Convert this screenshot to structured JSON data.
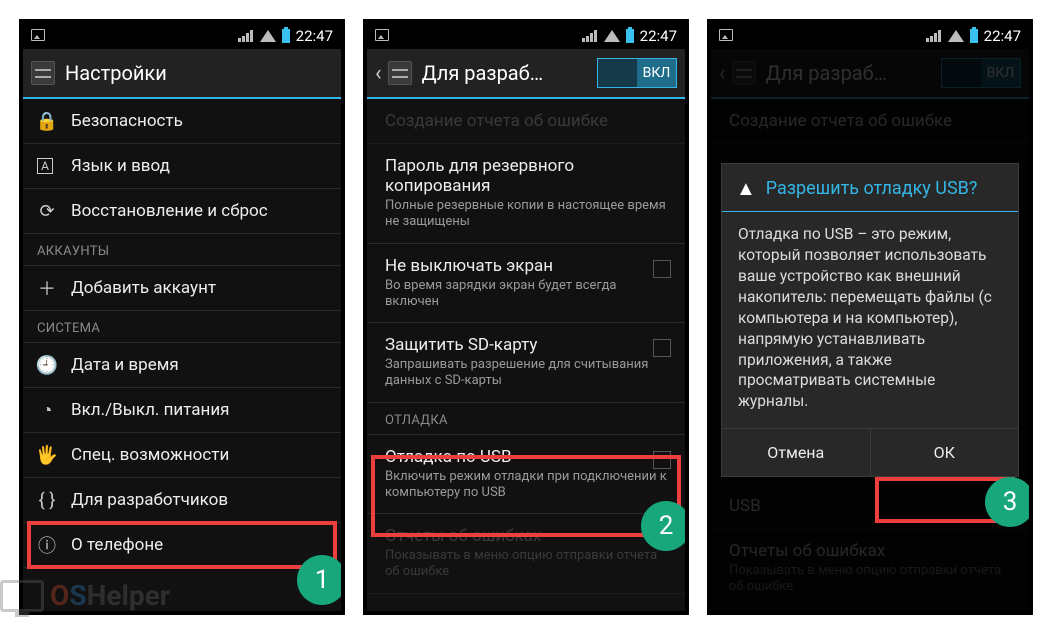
{
  "status": {
    "time": "22:47"
  },
  "watermark": {
    "o": "O",
    "s": "S",
    "h": "Helper"
  },
  "steps": [
    "1",
    "2",
    "3"
  ],
  "phone1": {
    "title": "Настройки",
    "items": [
      {
        "icon": "🔒",
        "label": "Безопасность"
      },
      {
        "icon": "A",
        "label": "Язык и ввод",
        "iconStyle": "letter"
      },
      {
        "icon": "⟳",
        "label": "Восстановление и сброс"
      }
    ],
    "accountsHeader": "АККАУНТЫ",
    "addAccount": {
      "icon": "＋",
      "label": "Добавить аккаунт"
    },
    "systemHeader": "СИСТЕМА",
    "system": [
      {
        "icon": "🕘",
        "label": "Дата и время"
      },
      {
        "icon": "◔",
        "label": "Вкл./Выкл. питания"
      },
      {
        "icon": "🖐",
        "label": "Спец. возможности"
      },
      {
        "icon": "{ }",
        "label": "Для разработчиков"
      },
      {
        "icon": "ⓘ",
        "label": "О телефоне"
      }
    ]
  },
  "phone2": {
    "title": "Для разраб…",
    "toggleLabel": "ВКЛ",
    "items": {
      "bugreport": {
        "title": "Создание отчета об ошибке"
      },
      "backuppw": {
        "title": "Пароль для резервного копирования",
        "sub": "Полные резервные копии в настоящее время не защищены"
      },
      "stayon": {
        "title": "Не выключать экран",
        "sub": "Во время зарядки экран будет всегда включен"
      },
      "protectsd": {
        "title": "Защитить SD-карту",
        "sub": "Запрашивать разрешение для считывания данных с SD-карты"
      },
      "debugHeader": "ОТЛАДКА",
      "usb": {
        "title": "Отладка по USB",
        "sub": "Включить режим отладки при подключении к компьютеру по USB"
      },
      "bugrmenu": {
        "title": "Отчеты об ошибках",
        "sub": "Показывать в меню опцию отправки отчета об ошибке"
      }
    }
  },
  "phone3": {
    "title": "Для разраб…",
    "toggleLabel": "ВКЛ",
    "bg": {
      "bugreport": "Создание отчета об ошибке",
      "usbLabel": "USB",
      "bugrmenu": {
        "title": "Отчеты об ошибках",
        "sub": "Показывать в меню опцию отправки отчета об ошибке"
      }
    },
    "dialog": {
      "title": "Разрешить отладку USB?",
      "body": "Отладка по USB – это режим, который позволяет использовать ваше устройство как внешний накопитель: перемещать файлы (с компьютера и на компьютер), напрямую устанавливать приложения, а также просматривать системные журналы.",
      "cancel": "Отмена",
      "ok": "ОК"
    }
  }
}
